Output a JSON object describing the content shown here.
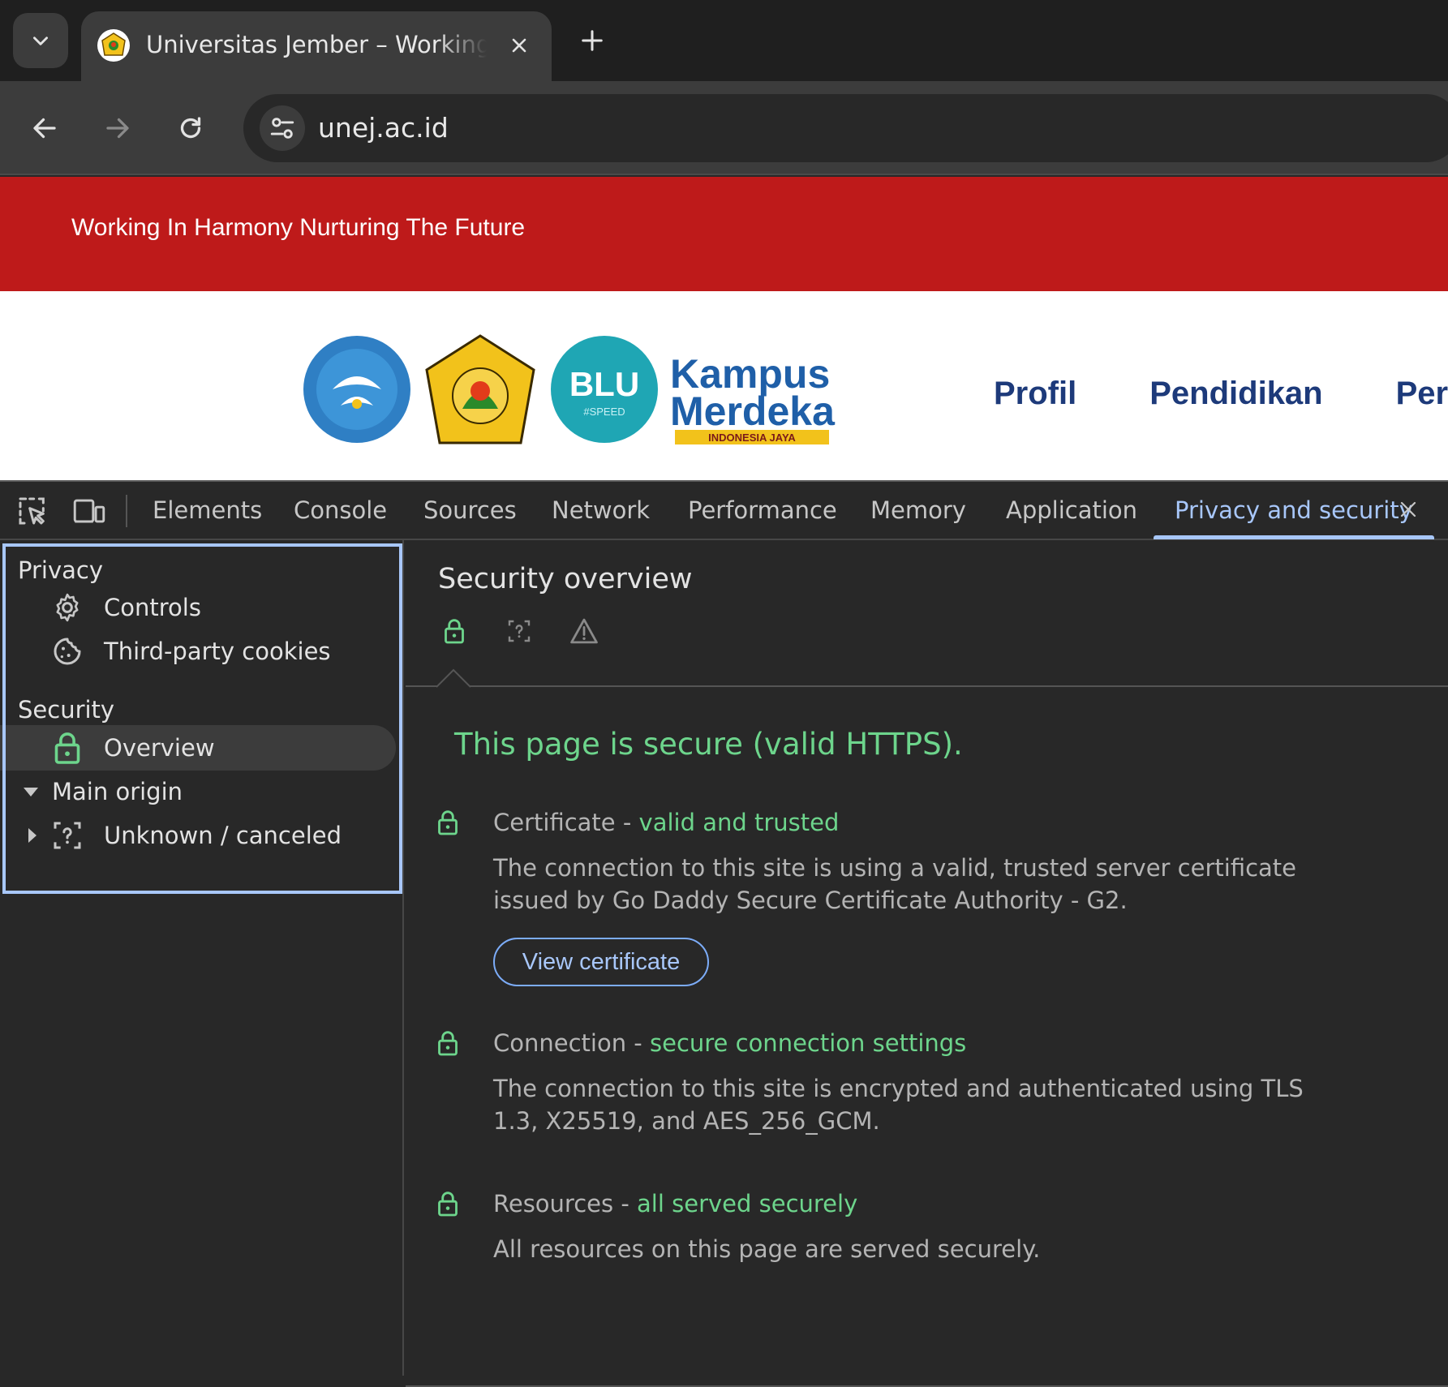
{
  "browser": {
    "tab": {
      "title": "Universitas Jember – Working in Harmony Nurturing The Future",
      "favicon": "unej-logo"
    },
    "url": "unej.ac.id"
  },
  "page": {
    "tagline": "Working In Harmony Nurturing The Future",
    "nav": [
      "Profil",
      "Pendidikan",
      "Per"
    ],
    "logos": {
      "blu": "BLU",
      "blu_sub": "#SPEED",
      "kampus": "Kampus",
      "merdeka": "Merdeka",
      "merdeka_sub": "INDONESIA JAYA"
    }
  },
  "devtools": {
    "tabs": [
      "Elements",
      "Console",
      "Sources",
      "Network",
      "Performance",
      "Memory",
      "Application",
      "Privacy and security"
    ],
    "sidebar": {
      "privacy_heading": "Privacy",
      "controls": "Controls",
      "cookies": "Third-party cookies",
      "security_heading": "Security",
      "overview": "Overview",
      "main_origin": "Main origin",
      "unknown": "Unknown / canceled"
    },
    "overview": {
      "title": "Security overview",
      "summary": "This page is secure (valid HTTPS).",
      "certificate": {
        "label": "Certificate - ",
        "status": "valid and trusted",
        "description": "The connection to this site is using a valid, trusted server certificate issued by Go Daddy Secure Certificate Authority - G2.",
        "button": "View certificate"
      },
      "connection": {
        "label": "Connection - ",
        "status": "secure connection settings",
        "description": "The connection to this site is encrypted and authenticated using TLS 1.3, X25519, and AES_256_GCM."
      },
      "resources": {
        "label": "Resources - ",
        "status": "all served securely",
        "description": "All resources on this page are served securely."
      }
    }
  },
  "colors": {
    "secure_green": "#6dd58c",
    "accent_blue": "#a8c7fa",
    "banner_red": "#be1a1a",
    "nav_blue": "#1d3a7a"
  }
}
